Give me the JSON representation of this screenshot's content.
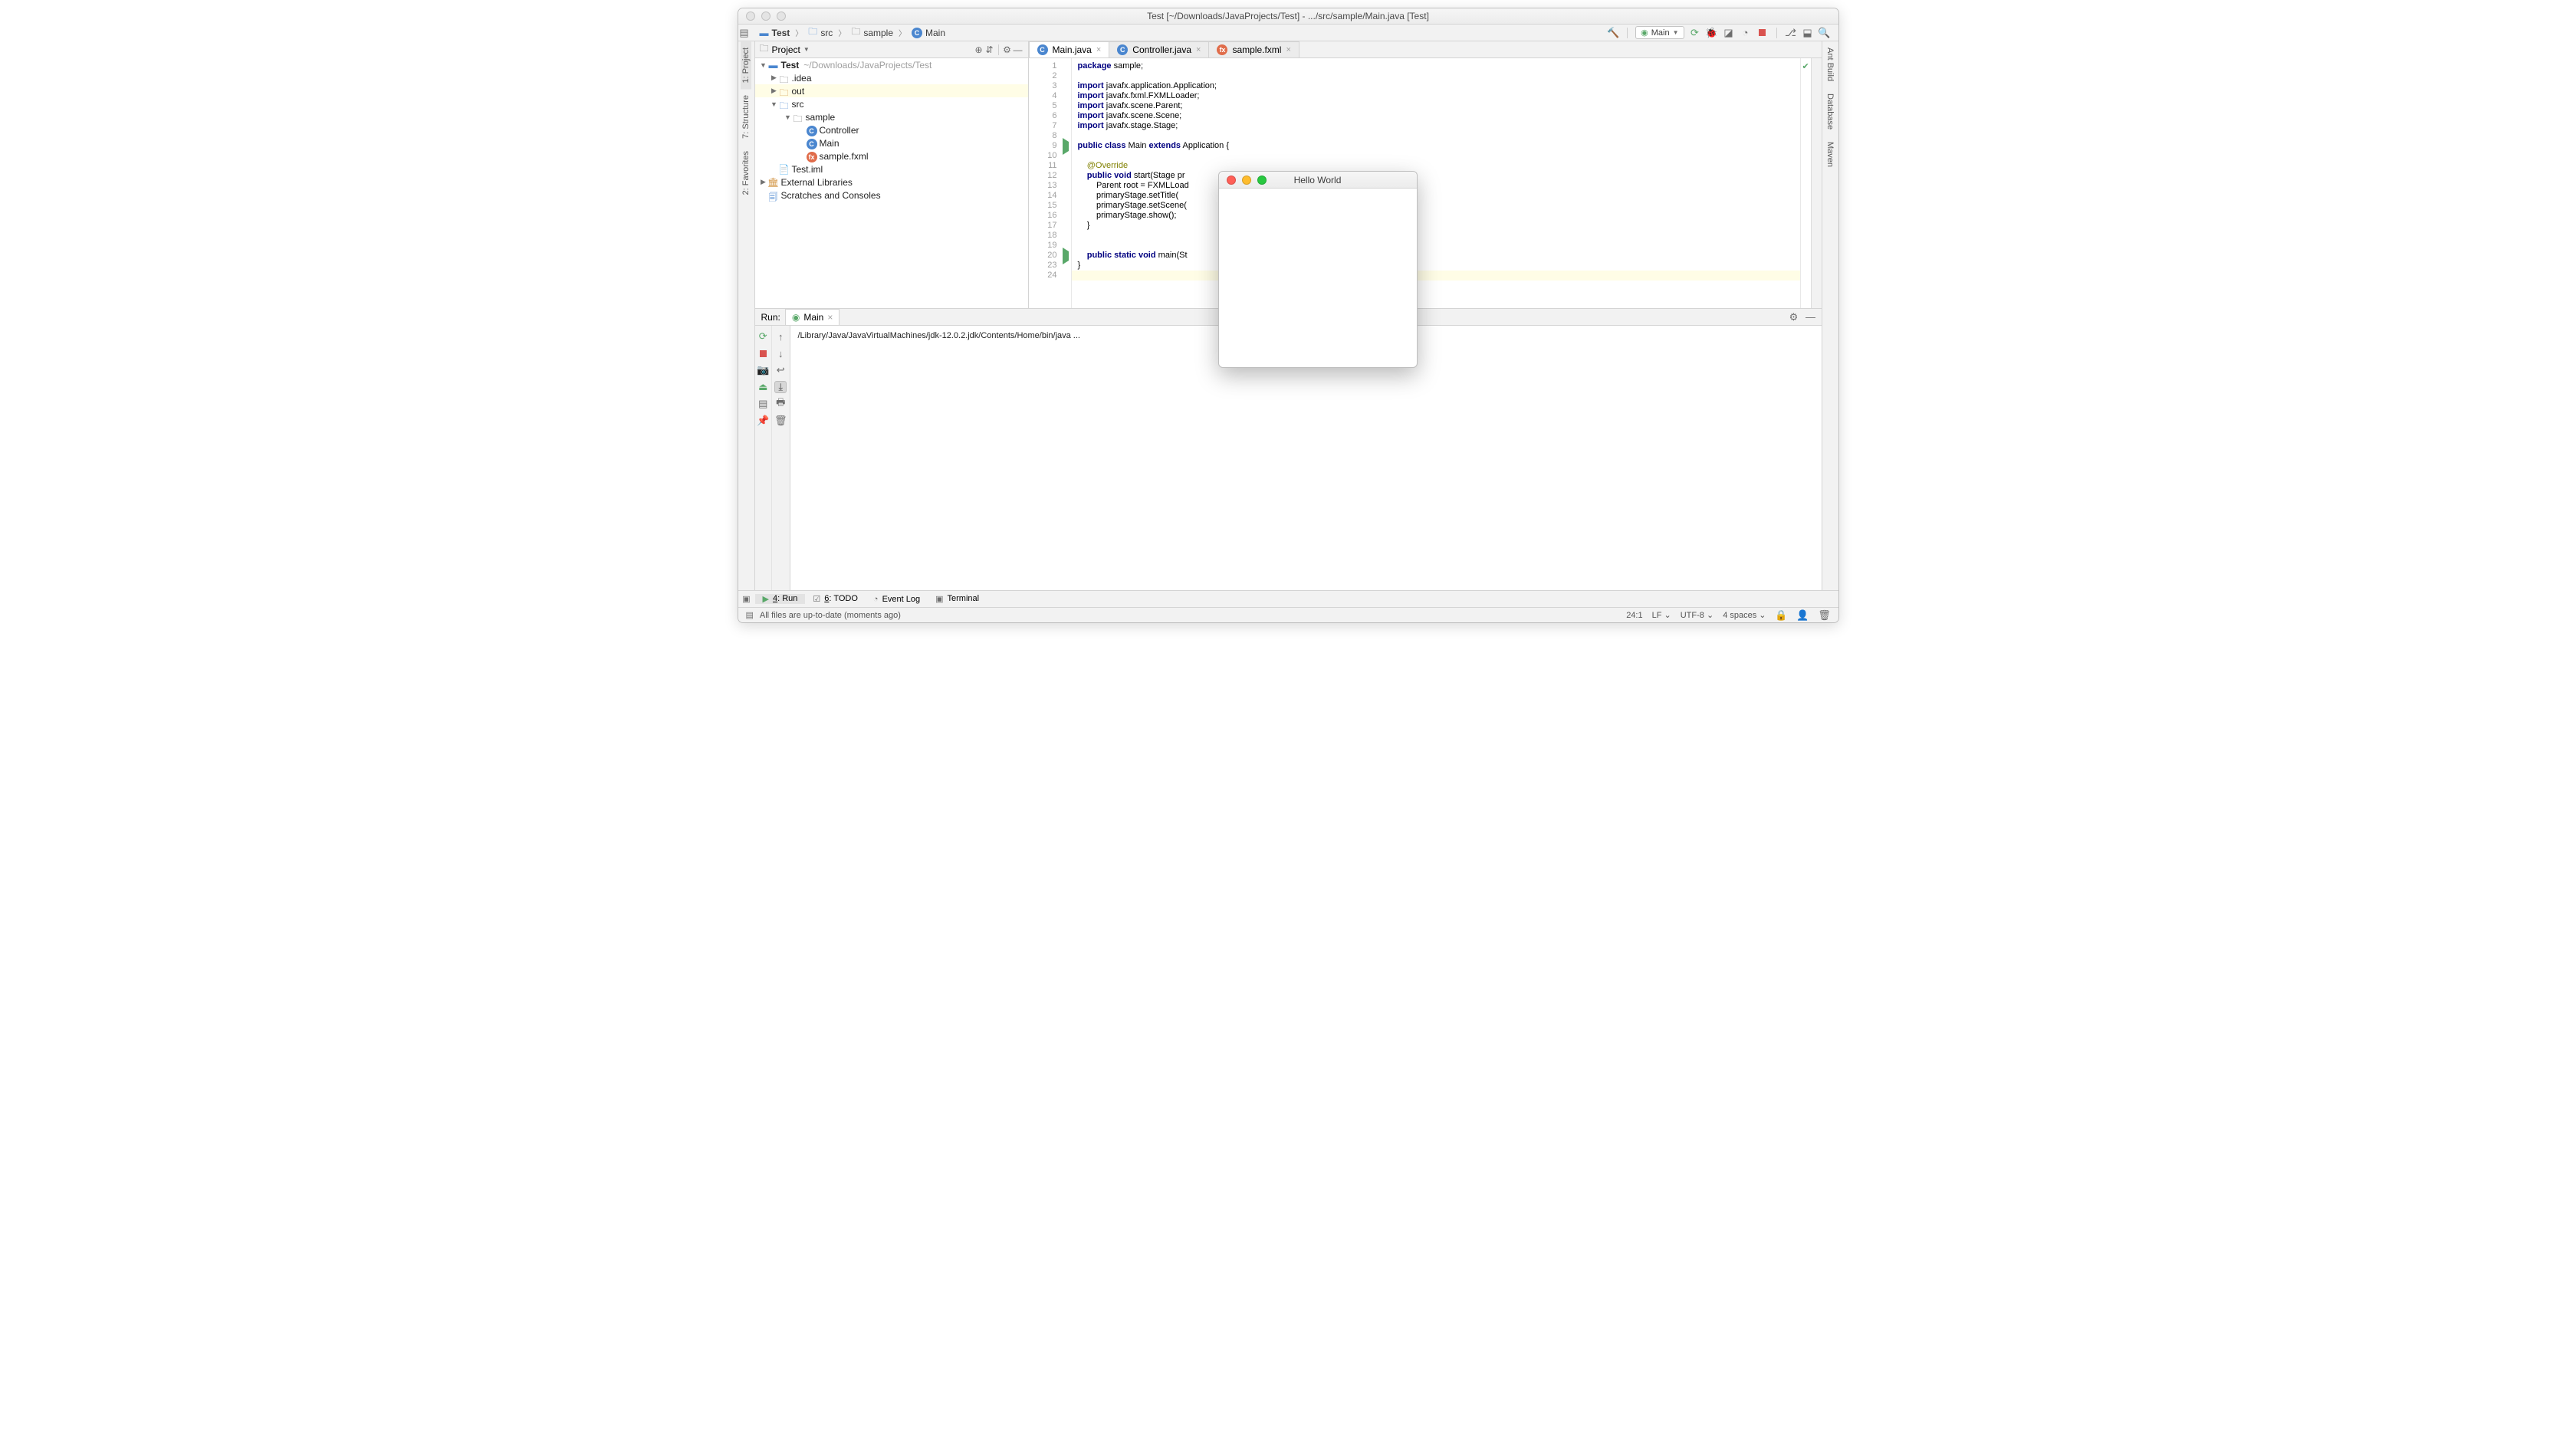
{
  "window_title": "Test [~/Downloads/JavaProjects/Test] - .../src/sample/Main.java [Test]",
  "breadcrumb": [
    "Test",
    "src",
    "sample",
    "Main"
  ],
  "run_config": "Main",
  "left_tabs": {
    "project": "1: Project",
    "structure": "7: Structure",
    "favorites": "2: Favorites"
  },
  "right_tabs": {
    "ant": "Ant Build",
    "database": "Database",
    "maven": "Maven"
  },
  "project_pane": {
    "title": "Project"
  },
  "tree": {
    "root": {
      "label": "Test",
      "path": "~/Downloads/JavaProjects/Test"
    },
    "idea": ".idea",
    "out": "out",
    "src": "src",
    "pkg": "sample",
    "controller": "Controller",
    "main": "Main",
    "fxml": "sample.fxml",
    "iml": "Test.iml",
    "ext": "External Libraries",
    "scratch": "Scratches and Consoles"
  },
  "editor_tabs": [
    {
      "label": "Main.java",
      "kind": "c"
    },
    {
      "label": "Controller.java",
      "kind": "c"
    },
    {
      "label": "sample.fxml",
      "kind": "f"
    }
  ],
  "code_lines": [
    {
      "n": 1,
      "html": "<span class='kw'>package</span> sample;"
    },
    {
      "n": 2,
      "html": ""
    },
    {
      "n": 3,
      "html": "<span class='kw'>import</span> javafx.application.Application;"
    },
    {
      "n": 4,
      "html": "<span class='kw'>import</span> javafx.fxml.FXMLLoader;"
    },
    {
      "n": 5,
      "html": "<span class='kw'>import</span> javafx.scene.Parent;"
    },
    {
      "n": 6,
      "html": "<span class='kw'>import</span> javafx.scene.Scene;"
    },
    {
      "n": 7,
      "html": "<span class='kw'>import</span> javafx.stage.Stage;"
    },
    {
      "n": 8,
      "html": ""
    },
    {
      "n": 9,
      "html": "<span class='kw'>public class</span> Main <span class='kw'>extends</span> Application {",
      "run": true
    },
    {
      "n": 10,
      "html": ""
    },
    {
      "n": 11,
      "html": "    <span class='ann'>@Override</span>"
    },
    {
      "n": 12,
      "html": "    <span class='kw'>public void</span> start(Stage pr"
    },
    {
      "n": 13,
      "html": "        Parent root = FXMLLoad                                        e.fxml<span class='str'>\"));</span>"
    },
    {
      "n": 14,
      "html": "        primaryStage.setTitle("
    },
    {
      "n": 15,
      "html": "        primaryStage.setScene("
    },
    {
      "n": 16,
      "html": "        primaryStage.show();"
    },
    {
      "n": 17,
      "html": "    }"
    },
    {
      "n": 18,
      "html": ""
    },
    {
      "n": 19,
      "html": ""
    },
    {
      "n": 20,
      "html": "    <span class='kw'>public static void</span> main(St",
      "run": true
    },
    {
      "n": 23,
      "html": "}"
    },
    {
      "n": 24,
      "html": "",
      "hl": true
    }
  ],
  "run": {
    "label": "Run:",
    "tab": "Main",
    "output": "/Library/Java/JavaVirtualMachines/jdk-12.0.2.jdk/Contents/Home/bin/java ..."
  },
  "bottom_tabs": {
    "run": "4: Run",
    "todo": "6: TODO",
    "eventlog": "Event Log",
    "terminal": "Terminal"
  },
  "status": {
    "msg": "All files are up-to-date (moments ago)",
    "caret": "24:1",
    "sep": "LF",
    "enc": "UTF-8",
    "indent": "4 spaces"
  },
  "fx_window_title": "Hello World"
}
